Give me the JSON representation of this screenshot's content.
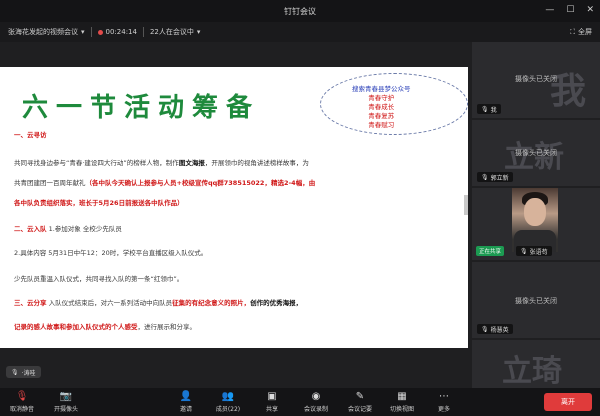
{
  "window": {
    "title": "钉钉会议",
    "controls": [
      "—",
      "☐",
      "✕"
    ]
  },
  "infobar": {
    "meeting_name": "张海花发起的视频会议",
    "timer": "00:24:14",
    "participants": "22人在会议中",
    "fullscreen": "全屏"
  },
  "slide": {
    "title": "六一节活动筹备",
    "slogans": [
      "搜索青春县梦公众号",
      "青春守护",
      "青春成长",
      "青春复苏",
      "青春赋习"
    ],
    "lines": [
      {
        "kind": "heading",
        "text": "一、云寻访"
      },
      {
        "kind": "mixed",
        "plain1": "共同寻找身边参与“青春·建设四大行动”的榜样人物，制作",
        "bold1": "图文海报",
        "plain2": "，开展领巾的视角讲述榜样故事，为"
      },
      {
        "kind": "mixed",
        "plain1": "共青团建团一百周年献礼",
        "bold1": "（各中队今天确认上报参与人员+校级宣传qq群738515022，精选2-4幅，由",
        "plain2": ""
      },
      {
        "kind": "red",
        "text": "各中队负责组织落实，班长于5月26日前报送各中队作品）"
      },
      {
        "kind": "mixed2",
        "red": "二、云入队",
        "plain": "1.参加对象 全校少先队员"
      },
      {
        "kind": "plain",
        "text": "2.具体内容 5月31日中午12：20时，学校平台直播区级入队仪式。"
      },
      {
        "kind": "plain",
        "text": "少先队员重温入队仪式，共同寻找入队的第一条“红领巾”。"
      },
      {
        "kind": "mixed3",
        "red": "三、云分享",
        "plain": "入队仪式结束后，对六一系列活动中向队员",
        "bold": "征集的有纪念意义的照片，",
        "blk": "创作的优秀海报，"
      },
      {
        "kind": "mixed4",
        "red": "记录的感人故事和参加入队仪式的个人感受",
        "plain": "，进行展示和分享。"
      }
    ]
  },
  "speaker": {
    "label": "·涛哇"
  },
  "participants": [
    {
      "bg_text": "我",
      "camera_text": "摄像头已关闭",
      "name": "我"
    },
    {
      "bg_text": "立新",
      "camera_text": "摄像头已关闭",
      "name": "郭立新"
    },
    {
      "bg_text": "",
      "camera_text": "",
      "name": "张语苟",
      "sharing": "正在共享"
    },
    {
      "bg_text": "",
      "camera_text": "摄像头已关闭",
      "name": "杨慧英"
    },
    {
      "bg_text": "立琦",
      "camera_text": "",
      "name": ""
    }
  ],
  "toolbar": {
    "items": [
      {
        "label": "取消静音",
        "icon": "🎙"
      },
      {
        "label": "开摄像头",
        "icon": "📷"
      },
      {
        "label": "邀请",
        "icon": "👤"
      },
      {
        "label": "成员(22)",
        "icon": "👥"
      },
      {
        "label": "共享",
        "icon": "▣"
      },
      {
        "label": "会议录制",
        "icon": "◉"
      },
      {
        "label": "会议记要",
        "icon": "✎"
      },
      {
        "label": "切换视图",
        "icon": "▦"
      },
      {
        "label": "更多",
        "icon": "⋯"
      }
    ],
    "leave": "离开"
  },
  "colors": {
    "accent_red": "#e03b3b",
    "slide_title_green": "#1e8a3c",
    "slide_red": "#d01818"
  }
}
